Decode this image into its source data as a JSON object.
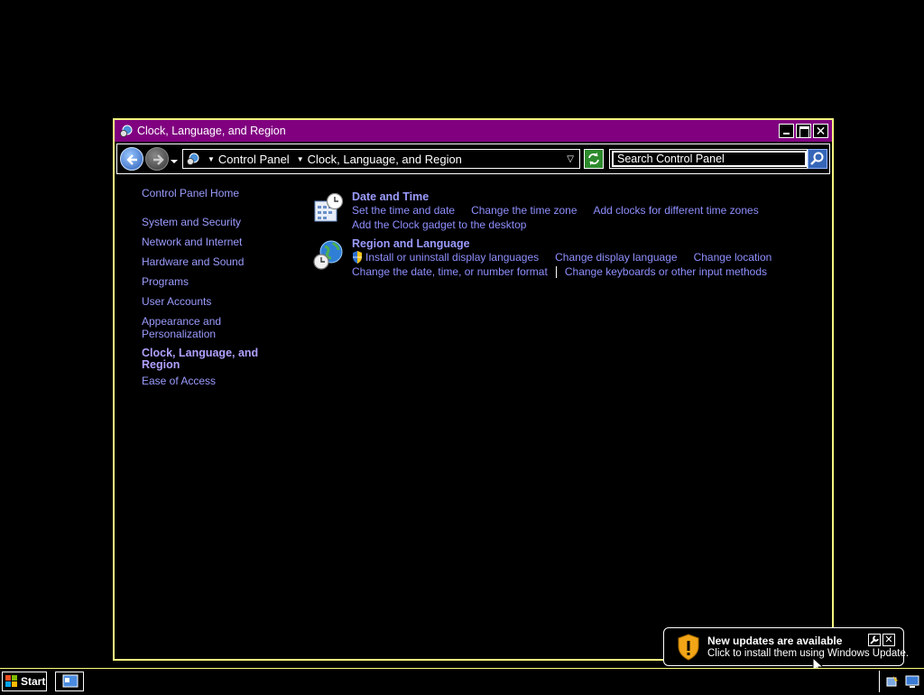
{
  "window": {
    "title": "Clock, Language, and Region"
  },
  "address_bar": {
    "crumbs": [
      "Control Panel",
      "Clock, Language, and Region"
    ]
  },
  "search": {
    "placeholder": "Search Control Panel"
  },
  "left_pane": {
    "home": "Control Panel Home",
    "items": [
      "System and Security",
      "Network and Internet",
      "Hardware and Sound",
      "Programs",
      "User Accounts",
      "Appearance and Personalization"
    ],
    "current": "Clock, Language, and Region",
    "after": "Ease of Access"
  },
  "categories": [
    {
      "title": "Date and Time",
      "icon": "calendar-clock-icon",
      "tasks_line1": [
        "Set the time and date",
        "Change the time zone",
        "Add clocks for different time zones"
      ],
      "tasks_line2": [
        "Add the Clock gadget to the desktop"
      ]
    },
    {
      "title": "Region and Language",
      "icon": "globe-clock-icon",
      "tasks_line1": [
        "Install or uninstall display languages",
        "Change display language",
        "Change location"
      ],
      "tasks_line2": [
        "Change the date, time, or number format",
        "Change keyboards or other input methods"
      ]
    }
  ],
  "taskbar": {
    "start_label": "Start"
  },
  "notification": {
    "title": "New updates are available",
    "text": "Click to install them using Windows Update."
  },
  "colors": {
    "titlebar": "#800080",
    "window_border": "#ffff80",
    "link": "#9b9bff"
  }
}
